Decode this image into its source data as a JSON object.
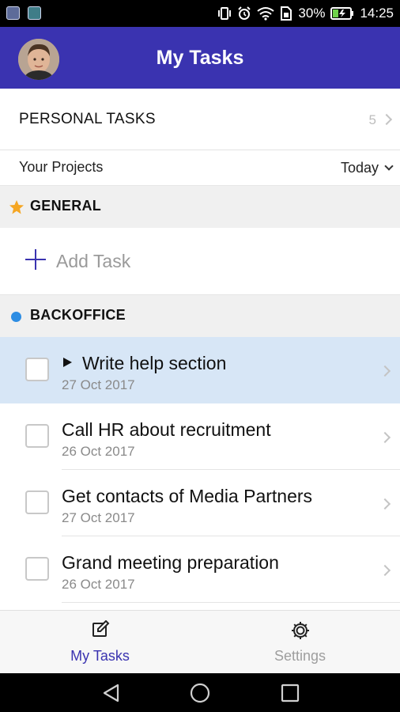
{
  "status_bar": {
    "battery_percent": "30%",
    "time": "14:25"
  },
  "header": {
    "title": "My Tasks"
  },
  "personal_tasks": {
    "label": "PERSONAL TASKS",
    "count": "5"
  },
  "filter": {
    "label": "Your Projects",
    "date_value": "Today"
  },
  "sections": [
    {
      "name": "GENERAL",
      "icon": "star-icon",
      "icon_color": "#f5a623",
      "add_task_label": "Add Task"
    },
    {
      "name": "BACKOFFICE",
      "icon": "dot-icon",
      "icon_color": "#2d8de3",
      "tasks": [
        {
          "name": "Write help section",
          "date": "27 Oct 2017",
          "selected": true,
          "playing": true
        },
        {
          "name": "Call HR about recruitment",
          "date": "26 Oct 2017",
          "selected": false
        },
        {
          "name": "Get contacts of Media Partners",
          "date": "27 Oct 2017",
          "selected": false
        },
        {
          "name": "Grand meeting preparation",
          "date": "26 Oct 2017",
          "selected": false
        }
      ]
    }
  ],
  "bottom_nav": {
    "items": [
      {
        "label": "My Tasks",
        "icon": "edit-icon",
        "active": true
      },
      {
        "label": "Settings",
        "icon": "gear-icon",
        "active": false
      }
    ]
  },
  "colors": {
    "accent": "#3a33b0",
    "selected_row": "#d7e6f6",
    "section_bg": "#f0f0f0"
  }
}
